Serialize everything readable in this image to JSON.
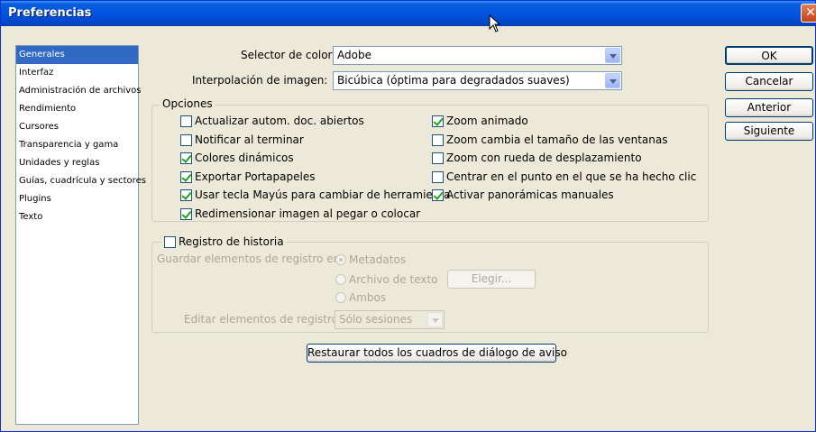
{
  "window": {
    "title": "Preferencias",
    "close_label": "✕"
  },
  "sidebar": {
    "items": [
      {
        "label": "Generales",
        "selected": true
      },
      {
        "label": "Interfaz"
      },
      {
        "label": "Administración de archivos"
      },
      {
        "label": "Rendimiento"
      },
      {
        "label": "Cursores"
      },
      {
        "label": "Transparencia y gama"
      },
      {
        "label": "Unidades y reglas"
      },
      {
        "label": "Guías, cuadrícula y sectores"
      },
      {
        "label": "Plugins"
      },
      {
        "label": "Texto"
      }
    ]
  },
  "color_picker": {
    "label": "Selector de color:",
    "value": "Adobe"
  },
  "interpolation": {
    "label": "Interpolación de imagen:",
    "value": "Bicúbica (óptima para degradados suaves)"
  },
  "options": {
    "title": "Opciones",
    "left": [
      {
        "label": "Actualizar autom. doc. abiertos",
        "checked": false
      },
      {
        "label": "Notificar al terminar",
        "checked": false
      },
      {
        "label": "Colores dinámicos",
        "checked": true
      },
      {
        "label": "Exportar Portapapeles",
        "checked": true
      },
      {
        "label": "Usar tecla Mayús para cambiar de herramienta",
        "checked": true
      },
      {
        "label": "Redimensionar imagen al pegar o colocar",
        "checked": true
      }
    ],
    "right": [
      {
        "label": "Zoom animado",
        "checked": true
      },
      {
        "label": "Zoom cambia el tamaño de las ventanas",
        "checked": false
      },
      {
        "label": "Zoom con rueda de desplazamiento",
        "checked": false
      },
      {
        "label": "Centrar en el punto en el que se ha hecho clic",
        "checked": false
      },
      {
        "label": "Activar panorámicas manuales",
        "checked": true
      }
    ]
  },
  "history": {
    "title": "Registro de historia",
    "checked": false,
    "save_label": "Guardar elementos de registro en:",
    "radios": [
      {
        "label": "Metadatos",
        "selected": true
      },
      {
        "label": "Archivo de texto",
        "selected": false
      },
      {
        "label": "Ambos",
        "selected": false
      }
    ],
    "choose_button": "Elegir...",
    "edit_label": "Editar elementos de registro:",
    "edit_value": "Sólo sesiones"
  },
  "reset_button": "Restaurar todos los cuadros de diálogo de aviso",
  "buttons": {
    "ok": "OK",
    "cancel": "Cancelar",
    "previous": "Anterior",
    "next": "Siguiente"
  }
}
